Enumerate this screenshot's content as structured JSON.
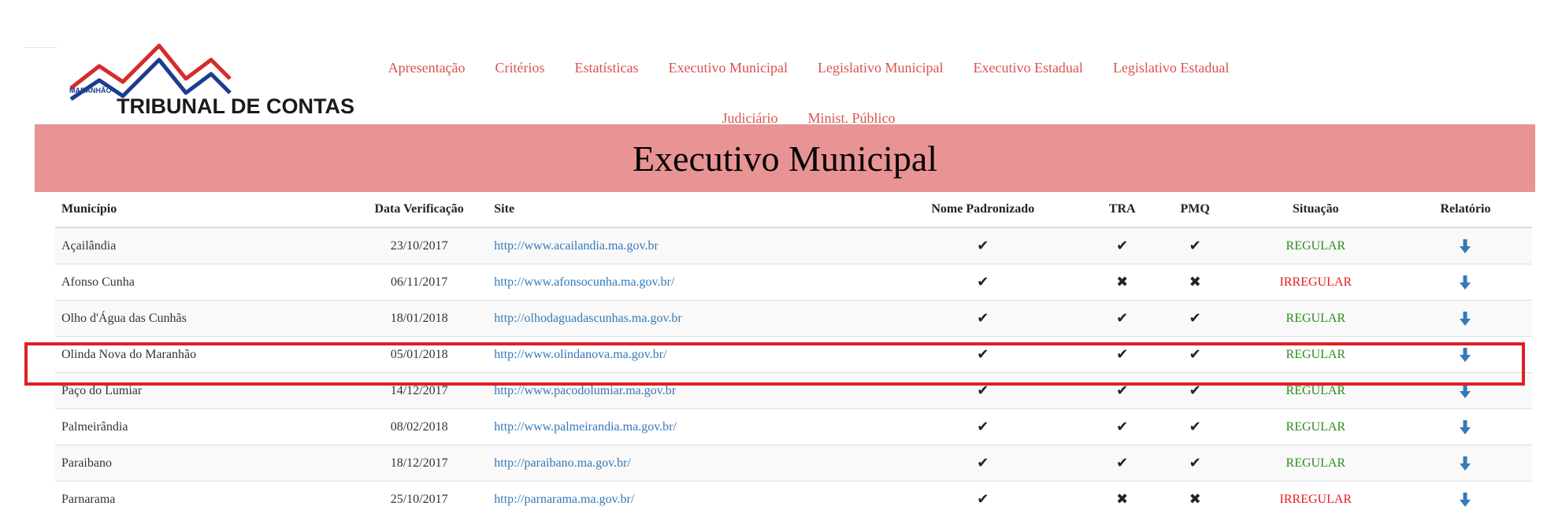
{
  "header": {
    "logo": {
      "state_text": "MARANHÃO",
      "name_text": "TRIBUNAL DE CONTAS"
    },
    "nav": [
      "Apresentação",
      "Critérios",
      "Estatísticas",
      "Executivo Municipal",
      "Legislativo Municipal",
      "Executivo Estadual",
      "Legislativo Estadual",
      "Judiciário",
      "Minist. Público"
    ]
  },
  "banner": {
    "title": "Executivo Municipal"
  },
  "table": {
    "columns": [
      "Município",
      "Data Verificação",
      "Site",
      "Nome Padronizado",
      "TRA",
      "PMQ",
      "Situação",
      "Relatório"
    ],
    "rows": [
      {
        "municipio": "Açailândia",
        "data": "23/10/2017",
        "site": "http://www.acailandia.ma.gov.br",
        "nome": "✔",
        "tra": "✔",
        "pmq": "✔",
        "situacao": "REGULAR",
        "status": "ok"
      },
      {
        "municipio": "Afonso Cunha",
        "data": "06/11/2017",
        "site": "http://www.afonsocunha.ma.gov.br/",
        "nome": "✔",
        "tra": "✖",
        "pmq": "✖",
        "situacao": "IRREGULAR",
        "status": "bad"
      },
      {
        "municipio": "Olho d'Água das Cunhãs",
        "data": "18/01/2018",
        "site": "http://olhodaguadascunhas.ma.gov.br",
        "nome": "✔",
        "tra": "✔",
        "pmq": "✔",
        "situacao": "REGULAR",
        "status": "ok"
      },
      {
        "municipio": "Olinda Nova do Maranhão",
        "data": "05/01/2018",
        "site": "http://www.olindanova.ma.gov.br/",
        "nome": "✔",
        "tra": "✔",
        "pmq": "✔",
        "situacao": "REGULAR",
        "status": "ok"
      },
      {
        "municipio": "Paço do Lumiar",
        "data": "14/12/2017",
        "site": "http://www.pacodolumiar.ma.gov.br",
        "nome": "✔",
        "tra": "✔",
        "pmq": "✔",
        "situacao": "REGULAR",
        "status": "ok"
      },
      {
        "municipio": "Palmeirândia",
        "data": "08/02/2018",
        "site": "http://www.palmeirandia.ma.gov.br/",
        "nome": "✔",
        "tra": "✔",
        "pmq": "✔",
        "situacao": "REGULAR",
        "status": "ok"
      },
      {
        "municipio": "Paraibano",
        "data": "18/12/2017",
        "site": "http://paraibano.ma.gov.br/",
        "nome": "✔",
        "tra": "✔",
        "pmq": "✔",
        "situacao": "REGULAR",
        "status": "ok"
      },
      {
        "municipio": "Parnarama",
        "data": "25/10/2017",
        "site": "http://parnarama.ma.gov.br/",
        "nome": "✔",
        "tra": "✖",
        "pmq": "✖",
        "situacao": "IRREGULAR",
        "status": "bad"
      }
    ]
  },
  "icons": {
    "check": "check-icon",
    "cross": "cross-icon",
    "report": "download-arrow-icon"
  },
  "colors": {
    "nav": "#d9534f",
    "banner": "#e89394",
    "regular": "#2e8b1e",
    "irregular": "#e8181e",
    "link": "#337ab7",
    "highlight": "#e01e26"
  }
}
